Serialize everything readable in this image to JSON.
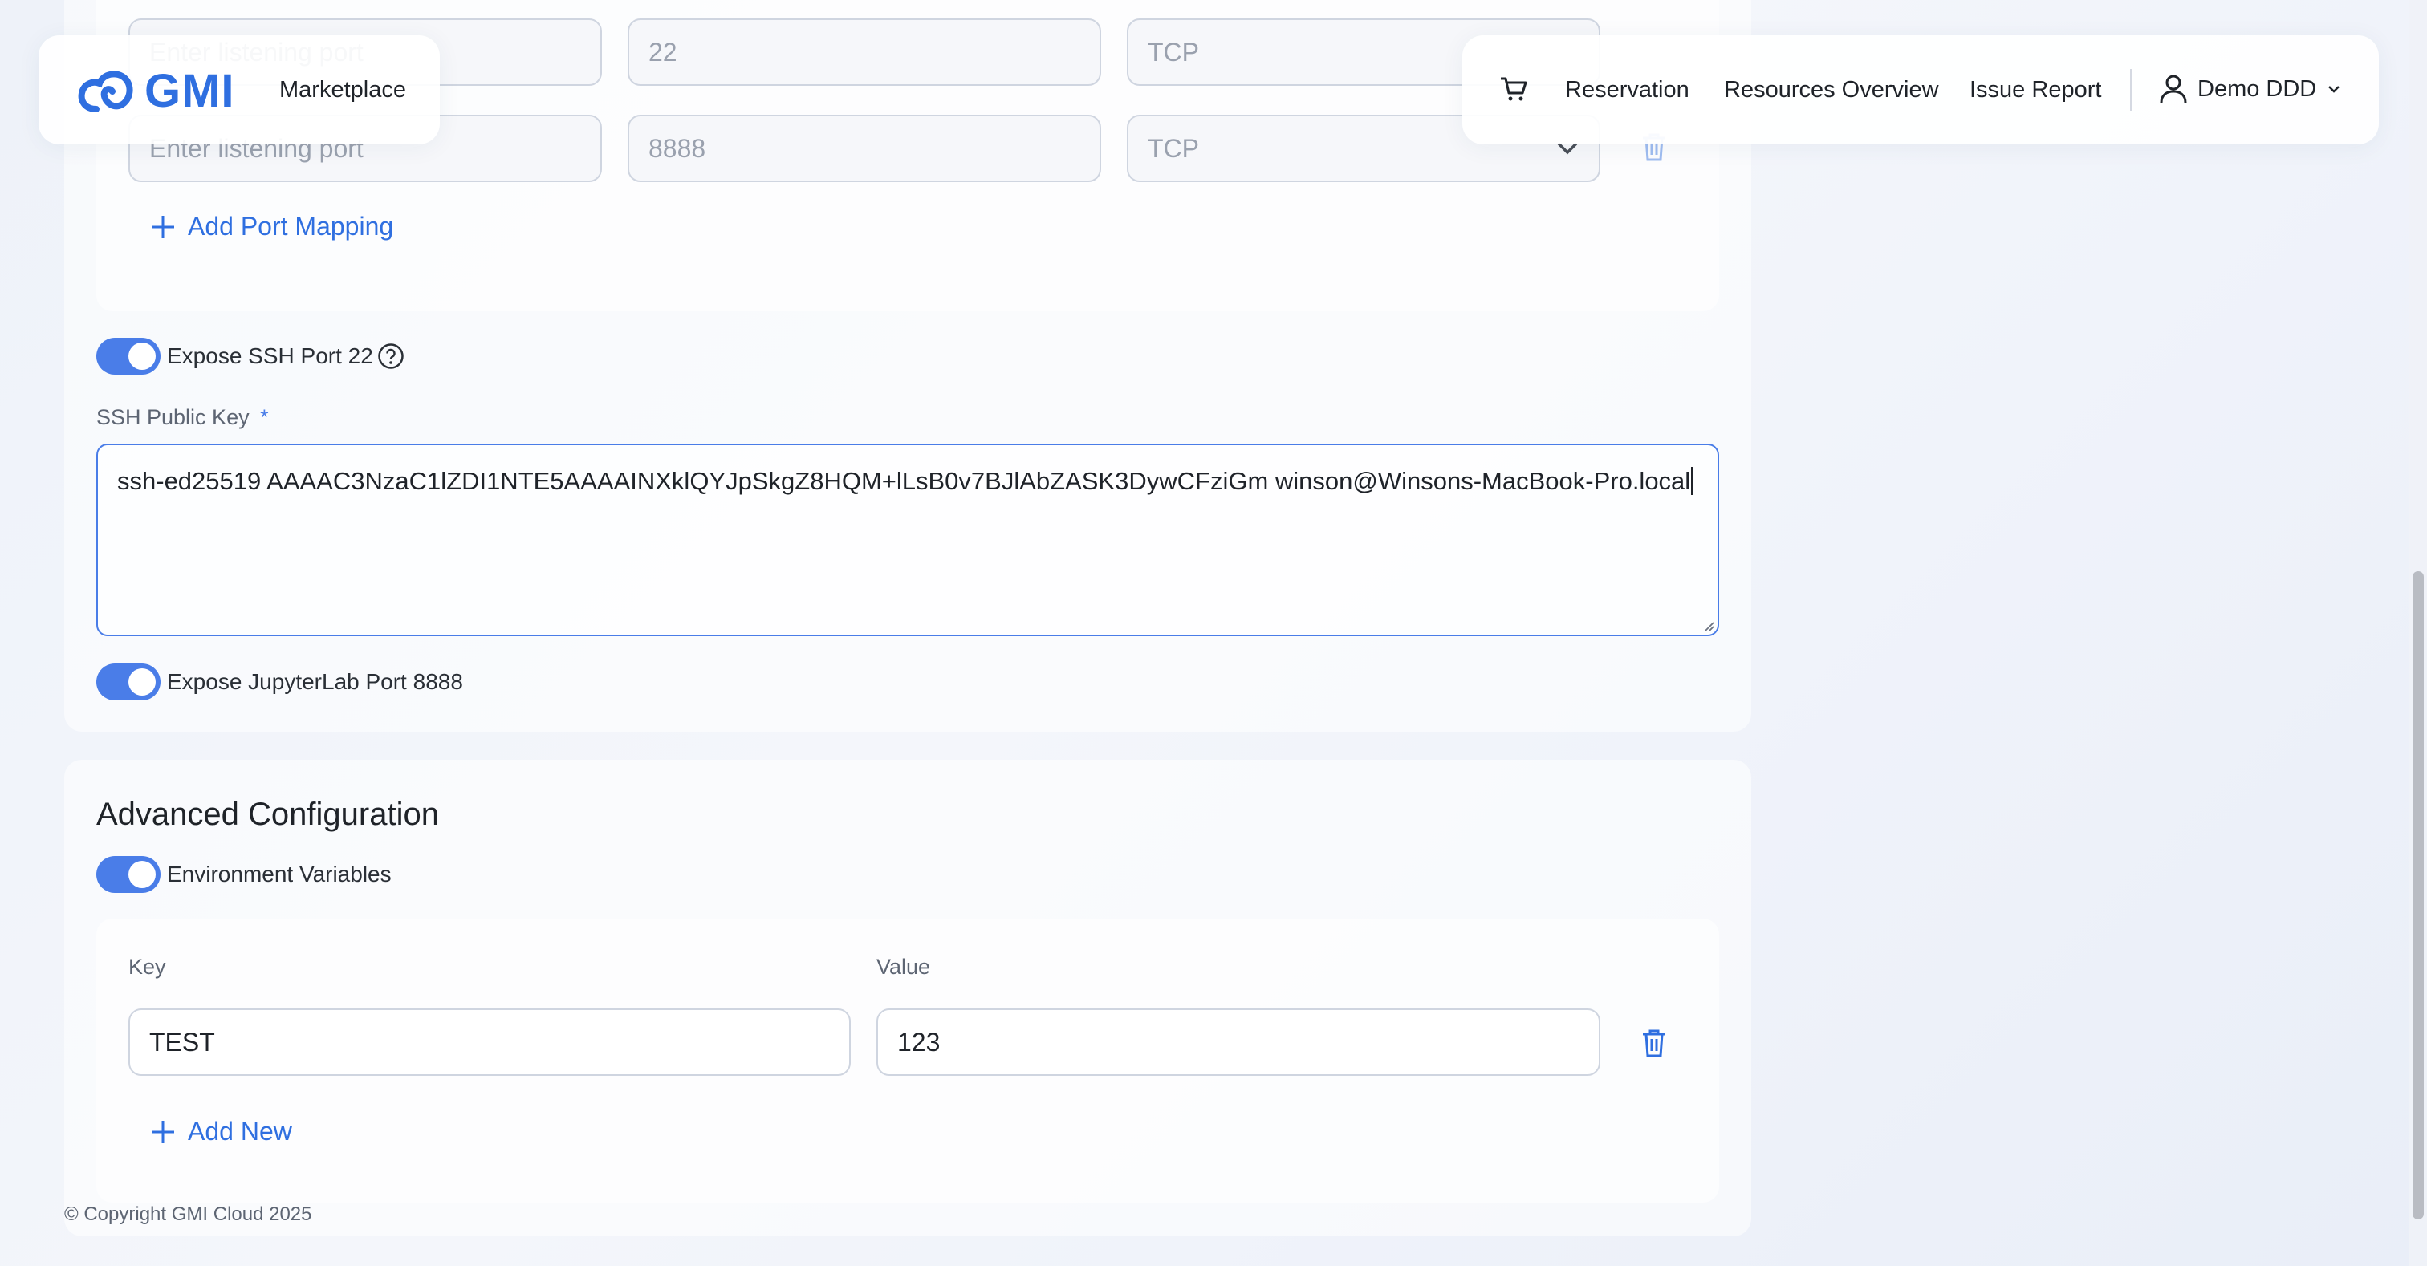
{
  "brand": {
    "logo_text": "GMI",
    "marketplace": "Marketplace"
  },
  "nav": {
    "reservation": "Reservation",
    "resources_overview": "Resources Overview",
    "issue_report": "Issue Report",
    "user": "Demo DDD"
  },
  "port_mappings": [
    {
      "listening_placeholder": "Enter listening port",
      "container_port": "22",
      "protocol": "TCP"
    },
    {
      "listening_placeholder": "Enter listening port",
      "container_port": "8888",
      "protocol": "TCP"
    }
  ],
  "add_port_mapping": "Add Port Mapping",
  "expose_ssh": {
    "label": "Expose SSH Port 22",
    "enabled": true
  },
  "ssh_key": {
    "label": "SSH Public Key",
    "required_mark": "*",
    "value": "ssh-ed25519 AAAAC3NzaC1lZDI1NTE5AAAAINXklQYJpSkgZ8HQM+lLsB0v7BJlAbZASK3DywCFziGm winson@Winsons-MacBook-Pro.local"
  },
  "expose_jupyter": {
    "label": "Expose JupyterLab Port 8888",
    "enabled": true
  },
  "advanced": {
    "title": "Advanced Configuration",
    "env_toggle_label": "Environment Variables",
    "env_enabled": true,
    "key_header": "Key",
    "value_header": "Value",
    "rows": [
      {
        "key": "TEST",
        "value": "123"
      }
    ],
    "add_new": "Add New"
  },
  "footer": {
    "copyright": "© Copyright GMI Cloud 2025"
  },
  "colors": {
    "accent": "#4a7de8",
    "link": "#2f6fe0"
  }
}
